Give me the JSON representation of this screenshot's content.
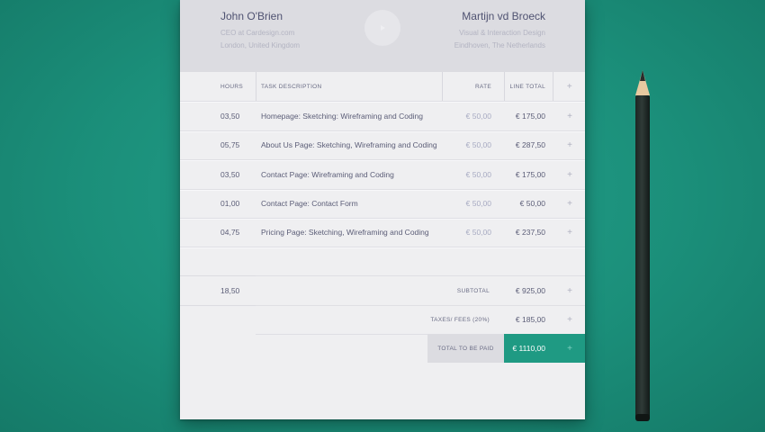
{
  "from": {
    "name": "John O'Brien",
    "line1": "CEO at Cardesign.com",
    "line2": "London, United Kingdom"
  },
  "to": {
    "name": "Martijn vd Broeck",
    "line1": "Visual & Interaction Design",
    "line2": "Eindhoven, The Netherlands"
  },
  "table": {
    "columns": {
      "hours": "HOURS",
      "description": "TASK DESCRIPTION",
      "rate": "RATE",
      "line_total": "LINE TOTAL",
      "add": "+"
    },
    "rows": [
      {
        "hours": "03,50",
        "description": "Homepage: Sketching: Wireframing and Coding",
        "rate": "€ 50,00",
        "total": "€ 175,00",
        "add": "+"
      },
      {
        "hours": "05,75",
        "description": "About Us Page: Sketching, Wireframing and Coding",
        "rate": "€ 50,00",
        "total": "€ 287,50",
        "add": "+"
      },
      {
        "hours": "03,50",
        "description": "Contact Page: Wireframing and Coding",
        "rate": "€ 50,00",
        "total": "€ 175,00",
        "add": "+"
      },
      {
        "hours": "01,00",
        "description": "Contact Page: Contact Form",
        "rate": "€ 50,00",
        "total": "€ 50,00",
        "add": "+"
      },
      {
        "hours": "04,75",
        "description": "Pricing Page: Sketching,  Wireframing and Coding",
        "rate": "€ 50,00",
        "total": "€ 237,50",
        "add": "+"
      }
    ]
  },
  "summary": {
    "total_hours": "18,50",
    "subtotal_label": "SUBTOTAL",
    "subtotal_value": "€ 925,00",
    "taxes_label": "TAXES/ FEES (20%)",
    "taxes_value": "€ 185,00",
    "total_label": "TOTAL TO BE PAID",
    "total_value": "€ 1110,00",
    "add": "+"
  },
  "colors": {
    "background": "#1b8f7a",
    "accent": "#1f9a83",
    "paper": "#efeff1",
    "header": "#dcdce1"
  }
}
